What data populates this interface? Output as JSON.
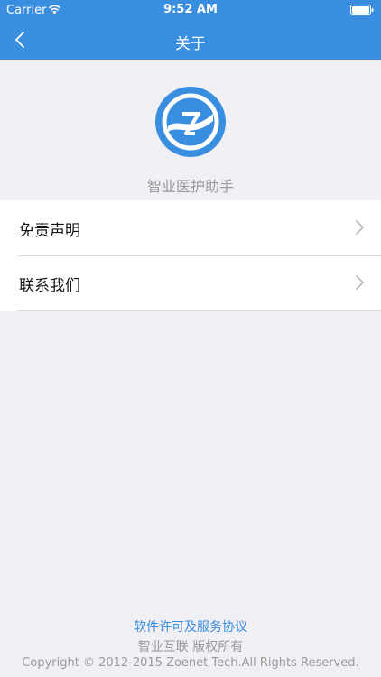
{
  "status_bar": {
    "carrier": "Carrier",
    "time": "9:52 AM"
  },
  "nav": {
    "title": "关于",
    "back_icon": "chevron-left-icon"
  },
  "app": {
    "name": "智业医护助手",
    "logo_icon": "app-logo-icon"
  },
  "menu": {
    "items": [
      {
        "label": "免责声明",
        "icon": "chevron-right-icon"
      },
      {
        "label": "联系我们",
        "icon": "chevron-right-icon"
      }
    ]
  },
  "footer": {
    "agreement_link": "软件许可及服务协议",
    "rights": "智业互联 版权所有",
    "copyright": "Copyright © 2012-2015 Zoenet Tech.All Rights Reserved."
  },
  "colors": {
    "accent": "#3a8ee0",
    "background": "#efeff4",
    "secondary_text": "#9a9a9a"
  }
}
